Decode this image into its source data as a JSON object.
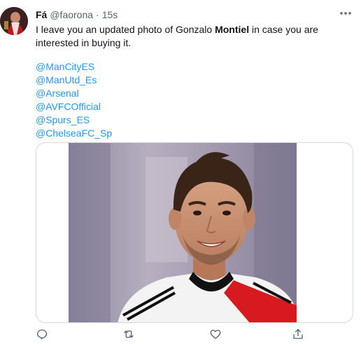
{
  "tweet": {
    "author_name": "Fá",
    "author_handle": "@faorona",
    "separator": "·",
    "time": "15s",
    "text_before": "I leave you an updated photo of Gonzalo ",
    "text_bold": "Montiel",
    "text_after": " in case you are interested in buying it.",
    "mentions": [
      "@ManCityES",
      "@ManUtd_Es",
      "@Arsenal",
      "@AVFCOfficial",
      "@Spurs_ES",
      "@ChelseaFC_Sp"
    ]
  },
  "icons": {
    "more": "more-horizontal-icon",
    "reply": "reply-icon",
    "retweet": "retweet-icon",
    "like": "heart-icon",
    "share": "share-icon"
  },
  "colors": {
    "text": "#0f1419",
    "secondary": "#536471",
    "link": "#1d9bf0",
    "border": "#cfd9de"
  }
}
